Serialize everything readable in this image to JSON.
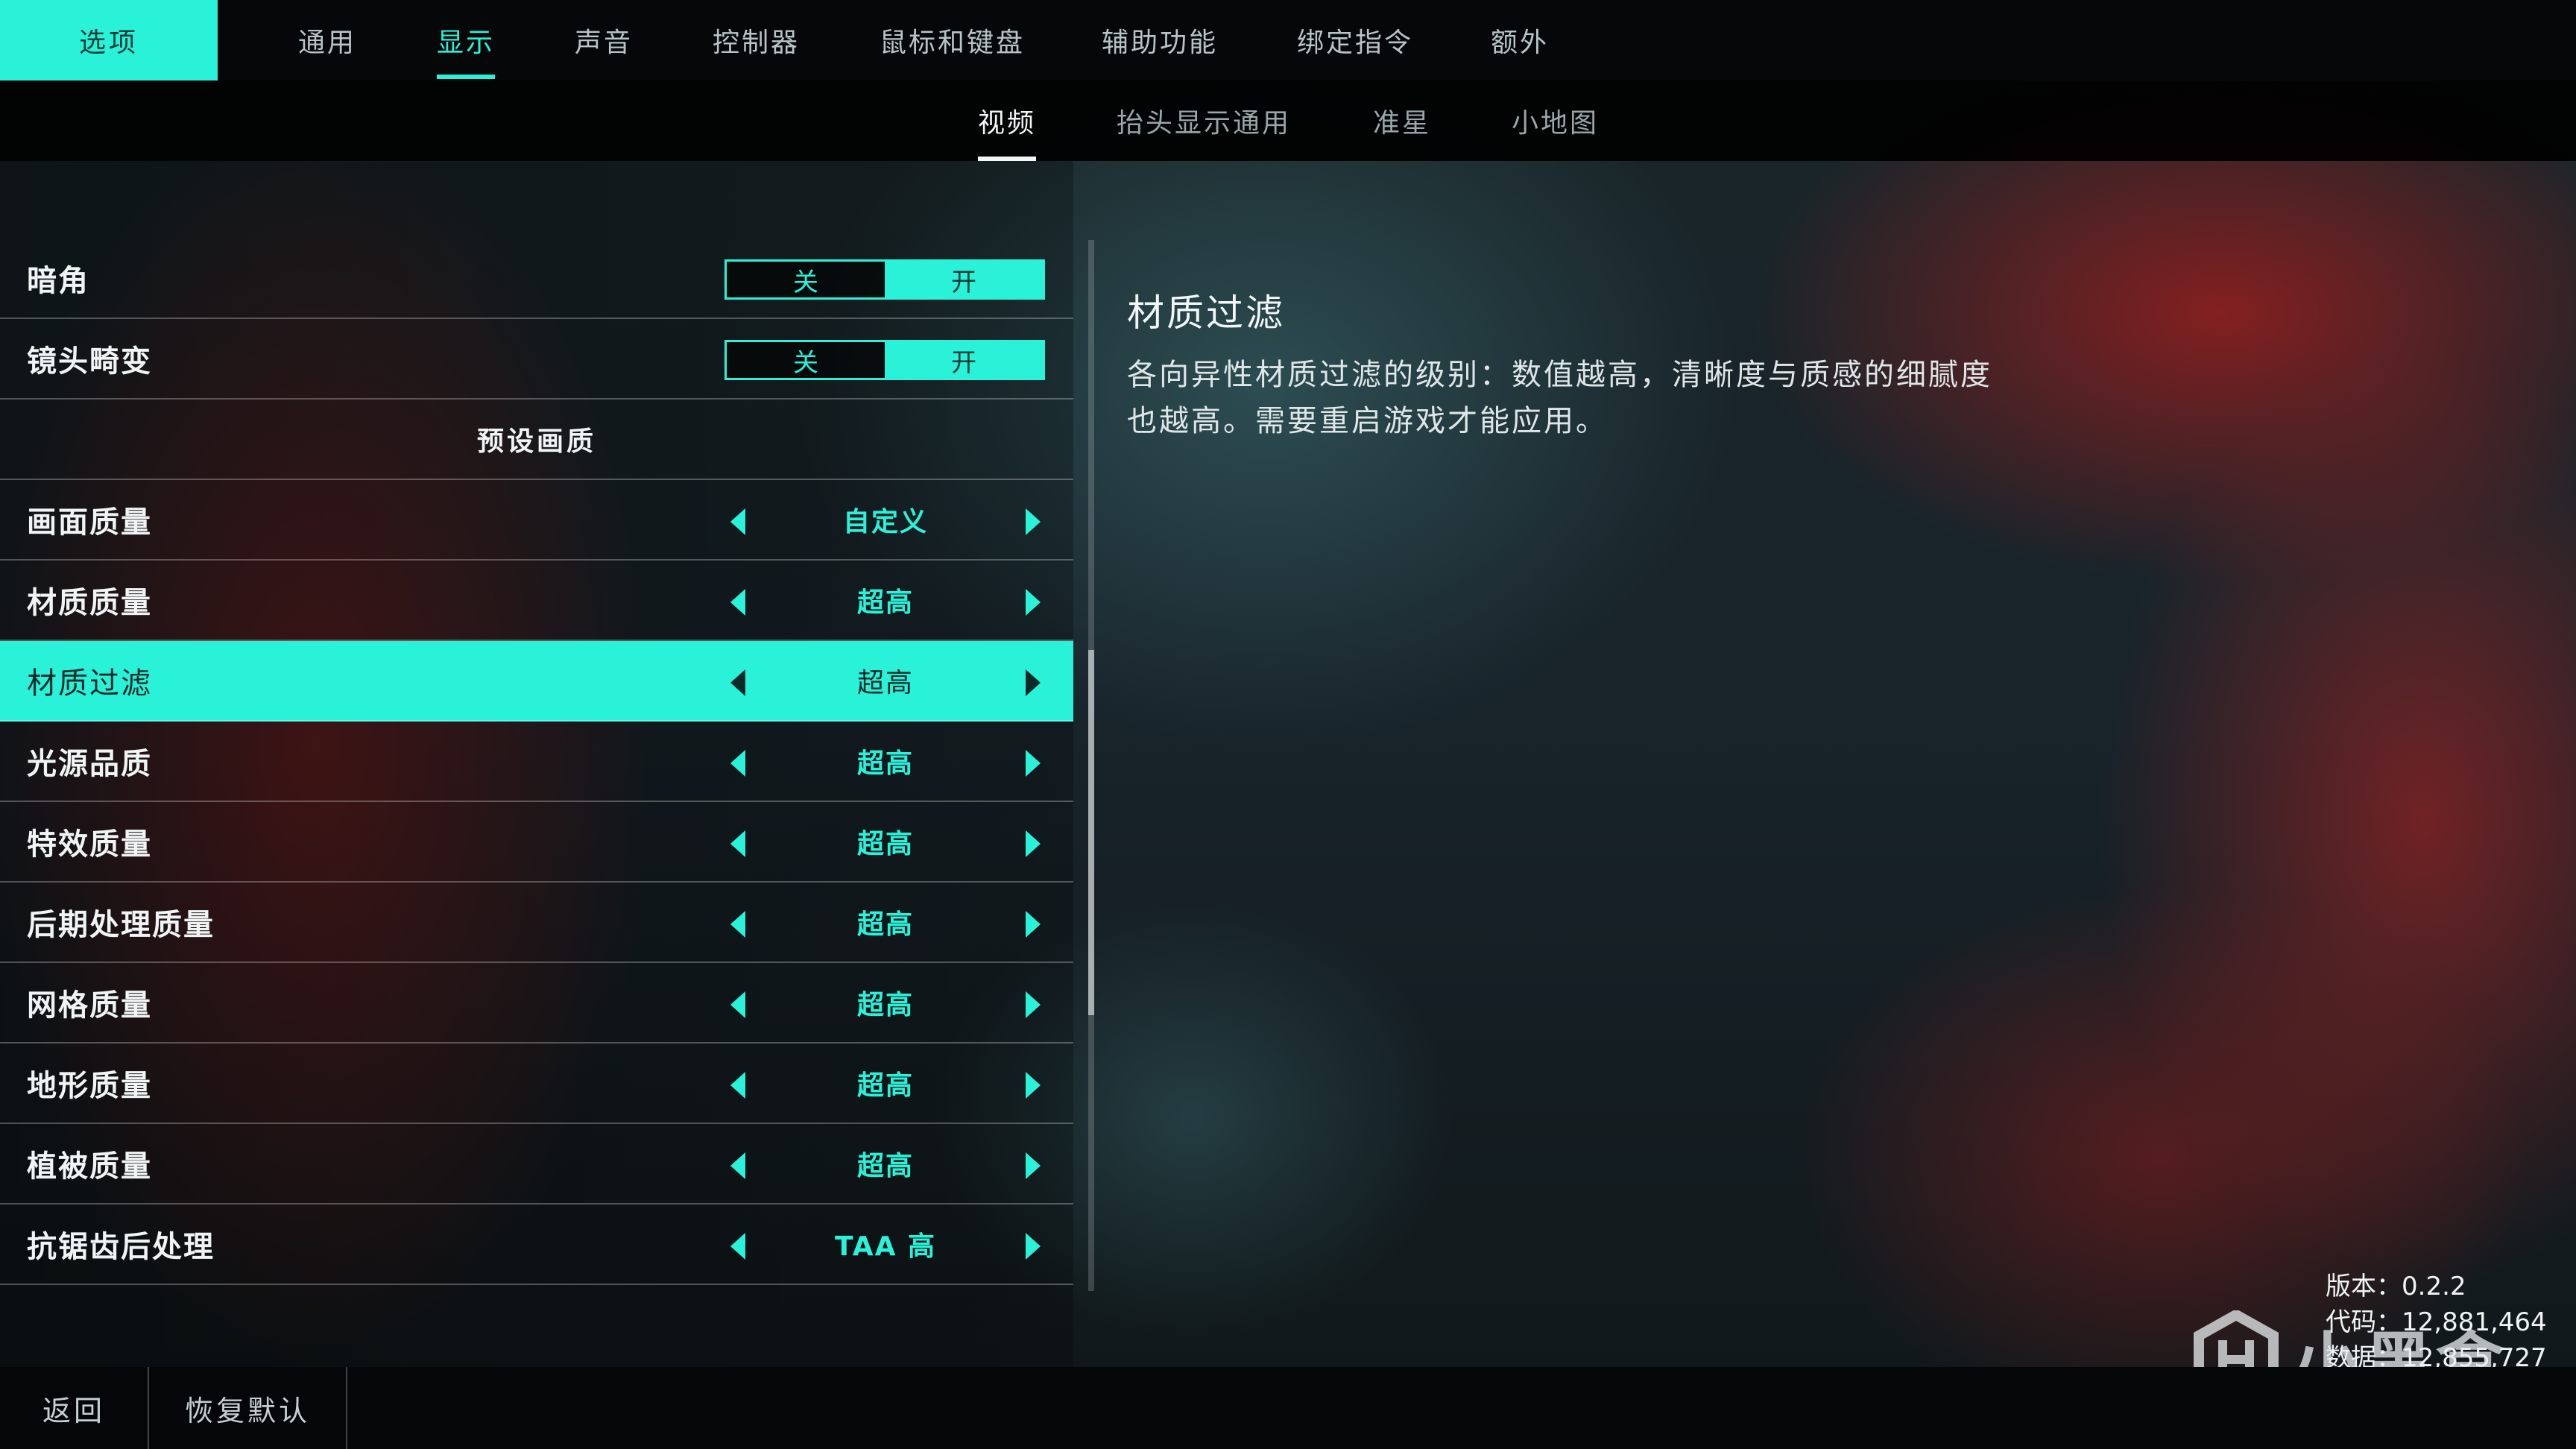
{
  "header": {
    "logo_label": "选项",
    "tabs": [
      {
        "label": "通用"
      },
      {
        "label": "显示",
        "active": true
      },
      {
        "label": "声音"
      },
      {
        "label": "控制器"
      },
      {
        "label": "鼠标和键盘"
      },
      {
        "label": "辅助功能"
      },
      {
        "label": "绑定指令"
      },
      {
        "label": "额外"
      }
    ]
  },
  "subtabs": [
    {
      "label": "视频",
      "active": true
    },
    {
      "label": "抬头显示通用"
    },
    {
      "label": "准星"
    },
    {
      "label": "小地图"
    }
  ],
  "settings": {
    "vignette": {
      "label": "暗角",
      "off": "关",
      "on": "开",
      "value": "on"
    },
    "lens_distortion": {
      "label": "镜头畸变",
      "off": "关",
      "on": "开",
      "value": "on"
    },
    "preset_section": "预设画质",
    "items": [
      {
        "label": "画面质量",
        "value": "自定义"
      },
      {
        "label": "材质质量",
        "value": "超高"
      },
      {
        "label": "材质过滤",
        "value": "超高",
        "selected": true
      },
      {
        "label": "光源品质",
        "value": "超高"
      },
      {
        "label": "特效质量",
        "value": "超高"
      },
      {
        "label": "后期处理质量",
        "value": "超高"
      },
      {
        "label": "网格质量",
        "value": "超高"
      },
      {
        "label": "地形质量",
        "value": "超高"
      },
      {
        "label": "植被质量",
        "value": "超高"
      },
      {
        "label": "抗锯齿后处理",
        "value": "TAA 高"
      }
    ]
  },
  "description": {
    "title": "材质过滤",
    "text": "各向异性材质过滤的级别：数值越高，清晰度与质感的细腻度也越高。需要重启游戏才能应用。"
  },
  "version_info": {
    "version": "版本：0.2.2",
    "code": "代码：12,881,464",
    "data": "数据：12,855,727"
  },
  "watermark": "小黑盒",
  "footer": {
    "back": "返回",
    "reset": "恢复默认"
  },
  "colors": {
    "accent": "#2af2d9",
    "panel_bg": "#050708"
  }
}
